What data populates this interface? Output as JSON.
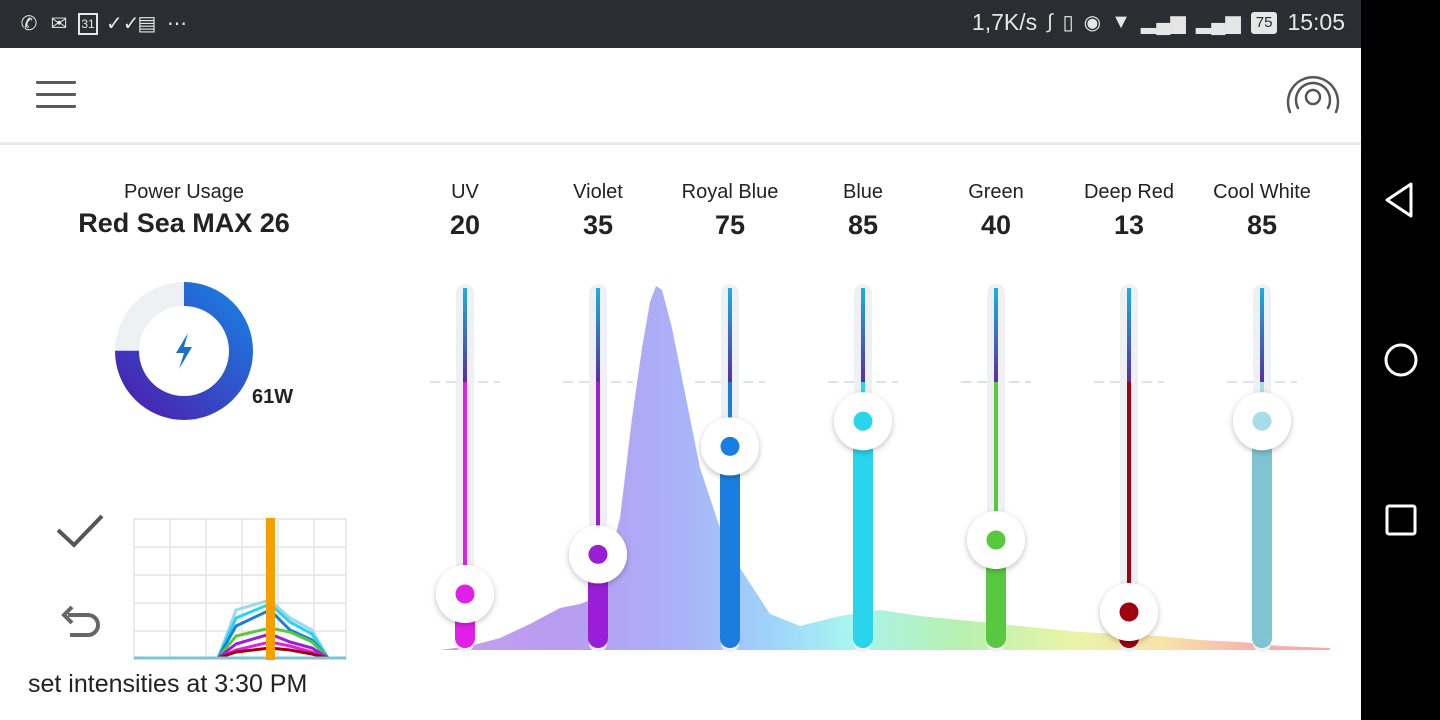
{
  "status_bar": {
    "date_icon_text": "31",
    "network_speed": "1,7K/s",
    "battery_level": "75",
    "time": "15:05",
    "left_icons": [
      "phone-call-icon",
      "mail-check-icon",
      "calendar-31-icon",
      "double-check-icon",
      "calendar-icon",
      "more-dots-icon"
    ],
    "right_icons": [
      "bluetooth-icon",
      "vibrate-icon",
      "eye-icon",
      "wifi-icon",
      "signal-1-icon",
      "signal-2-icon",
      "battery-icon"
    ]
  },
  "header": {
    "menu_icon": "hamburger-menu-icon",
    "connection_icon": "radar-connection-icon"
  },
  "power": {
    "label": "Power Usage",
    "device_name": "Red Sea MAX 26",
    "watts_text": "61W",
    "fraction": 0.75,
    "icon": "lightning-bolt-icon"
  },
  "schedule": {
    "confirm_icon": "checkmark-icon",
    "undo_icon": "undo-arrow-icon",
    "set_text": "set intensities at 3:30 PM"
  },
  "channels": [
    {
      "name": "UV",
      "value": "20",
      "level": 0.15,
      "color": "#e020e8",
      "track_color": "#e020e8"
    },
    {
      "name": "Violet",
      "value": "35",
      "level": 0.26,
      "color": "#9a1ed8",
      "track_color": "#9a1ed8"
    },
    {
      "name": "Royal Blue",
      "value": "75",
      "level": 0.56,
      "color": "#1a7ee0",
      "track_color": "#1a7ee0"
    },
    {
      "name": "Blue",
      "value": "85",
      "level": 0.63,
      "color": "#2ad4ec",
      "track_color": "#2ad4ec"
    },
    {
      "name": "Green",
      "value": "40",
      "level": 0.3,
      "color": "#58c840",
      "track_color": "#58c840"
    },
    {
      "name": "Deep Red",
      "value": "13",
      "level": 0.1,
      "color": "#a00010",
      "track_color": "#a00010"
    },
    {
      "name": "Cool White",
      "value": "85",
      "level": 0.63,
      "color": "#a8dce6",
      "track_color": "#7fc4d0"
    }
  ],
  "colors": {
    "accent": "#1a7ee0",
    "donut_track": "#eef0f4",
    "donut_start": "#4a1fb0",
    "donut_end": "#1a7ee0"
  },
  "nav": {
    "icons": [
      "back-triangle-icon",
      "home-circle-icon",
      "recents-square-icon"
    ]
  }
}
